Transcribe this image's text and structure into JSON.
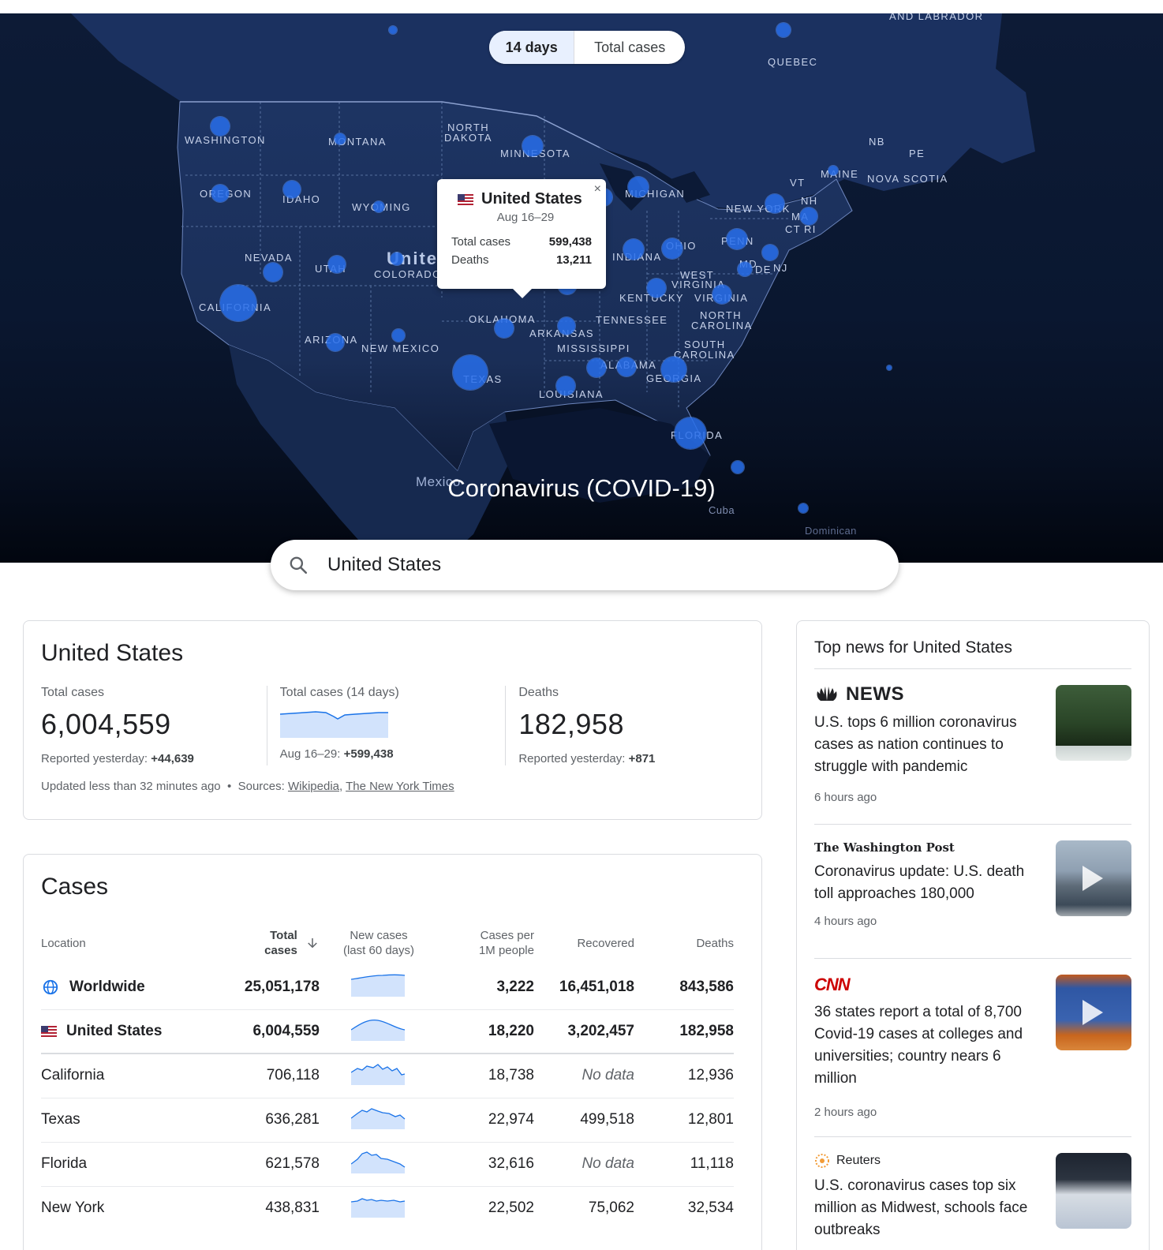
{
  "map": {
    "toggle": {
      "option1": "14 days",
      "option2": "Total cases"
    },
    "tooltip": {
      "title": "United States",
      "date": "Aug 16–29",
      "rows": [
        {
          "label": "Total cases",
          "value": "599,438"
        },
        {
          "label": "Deaths",
          "value": "13,211"
        }
      ],
      "close": "×"
    },
    "title": "Coronavirus (COVID-19)",
    "labels": {
      "washington": "WASHINGTON",
      "montana": "MONTANA",
      "north_dakota_1": "NORTH",
      "north_dakota_2": "DAKOTA",
      "minnesota": "MINNESOTA",
      "oregon": "OREGON",
      "idaho": "IDAHO",
      "wyoming": "WYOMING",
      "michigan": "MICHIGAN",
      "nevada": "NEVADA",
      "utah": "UTAH",
      "colorado": "COLORADO",
      "indiana": "INDIANA",
      "ohio": "OHIO",
      "california": "CALIFORNIA",
      "arizona": "ARIZONA",
      "new_mexico": "NEW MEXICO",
      "oklahoma": "OKLAHOMA",
      "arkansas": "ARKANSAS",
      "tennessee": "TENNESSEE",
      "kentucky": "KENTUCKY",
      "west_1": "WEST",
      "virginia_w": "VIRGINIA",
      "virginia": "VIRGINIA",
      "north_1": "NORTH",
      "carolina_n": "CAROLINA",
      "south_1": "SOUTH",
      "carolina_s": "CAROLINA",
      "mississippi": "MISSISSIPPI",
      "alabama": "ALABAMA",
      "georgia": "GEORGIA",
      "texas": "TEXAS",
      "louisiana": "LOUISIANA",
      "florida": "FLORIDA",
      "new_york": "NEW YORK",
      "penn": "PENN",
      "md": "MD",
      "de": "DE",
      "nj": "NJ",
      "maine": "MAINE",
      "vt": "VT",
      "nh": "NH",
      "ma": "MA",
      "ct": "CT",
      "ri": "RI",
      "quebec": "QUEBEC",
      "labrador": "AND LABRADOR",
      "nb": "NB",
      "pe": "PE",
      "nova_scotia": "NOVA SCOTIA",
      "united": "Unite",
      "mexico": "Mexico",
      "cuba": "Cuba",
      "dominican": "Dominican"
    }
  },
  "search": {
    "value": "United States"
  },
  "summary": {
    "title": "United States",
    "total_cases": {
      "label": "Total cases",
      "value": "6,004,559",
      "sub_label": "Reported yesterday:",
      "sub_value": "+44,639"
    },
    "total_14": {
      "label": "Total cases (14 days)",
      "sub_label": "Aug 16–29:",
      "sub_value": "+599,438"
    },
    "deaths": {
      "label": "Deaths",
      "value": "182,958",
      "sub_label": "Reported yesterday:",
      "sub_value": "+871"
    },
    "updated": "Updated less than 32 minutes ago",
    "sources_label": "Sources:",
    "source1": "Wikipedia",
    "source2": "The New York Times"
  },
  "cases": {
    "title": "Cases",
    "headers": {
      "location": "Location",
      "total_1": "Total",
      "total_2": "cases",
      "new_1": "New cases",
      "new_2": "(last 60 days)",
      "per_1": "Cases per",
      "per_2": "1M people",
      "recovered": "Recovered",
      "deaths": "Deaths"
    },
    "rows": [
      {
        "location": "Worldwide",
        "total": "25,051,178",
        "per": "3,222",
        "recovered": "16,451,018",
        "deaths": "843,586"
      },
      {
        "location": "United States",
        "total": "6,004,559",
        "per": "18,220",
        "recovered": "3,202,457",
        "deaths": "182,958"
      },
      {
        "location": "California",
        "total": "706,118",
        "per": "18,738",
        "recovered": "No data",
        "deaths": "12,936"
      },
      {
        "location": "Texas",
        "total": "636,281",
        "per": "22,974",
        "recovered": "499,518",
        "deaths": "12,801"
      },
      {
        "location": "Florida",
        "total": "621,578",
        "per": "32,616",
        "recovered": "No data",
        "deaths": "11,118"
      },
      {
        "location": "New York",
        "total": "438,831",
        "per": "22,502",
        "recovered": "75,062",
        "deaths": "32,534"
      }
    ]
  },
  "news": {
    "title": "Top news for United States",
    "articles": [
      {
        "source": "NEWS",
        "headline": "U.S. tops 6 million coronavirus cases as nation continues to struggle with pandemic",
        "time": "6 hours ago"
      },
      {
        "source": "The Washington Post",
        "headline": "Coronavirus update: U.S. death toll approaches 180,000",
        "time": "4 hours ago"
      },
      {
        "source": "CNN",
        "headline": "36 states report a total of 8,700 Covid-19 cases at colleges and universities; country nears 6 million",
        "time": "2 hours ago"
      },
      {
        "source": "Reuters",
        "headline": "U.S. coronavirus cases top six million as Midwest, schools face outbreaks",
        "time": ""
      }
    ]
  },
  "colors": {
    "map_bg": "#0d1b36",
    "dot": "#286eeb",
    "accent": "#1a73e8",
    "spark": "#4285f4"
  },
  "icons": {
    "search": "search-icon",
    "globe": "globe-icon",
    "flag": "us-flag-icon",
    "sort": "arrow-down-icon",
    "close": "close-icon",
    "play": "play-icon"
  }
}
